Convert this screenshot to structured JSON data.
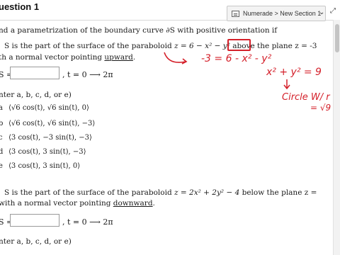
{
  "header": {
    "title": "uestion 1"
  },
  "numerade": {
    "label": "Numerade > New Section 1",
    "chevron": "⌄",
    "expand": "⤢"
  },
  "q1": {
    "intro": "nd a parametrization of the boundary curve ∂S with positive orientation if",
    "line1_a": "S is the part of the surface of the paraboloid ",
    "line1_math": "z = 6 − x² − y²",
    "line1_b": " above the plane ",
    "plane": "z = -3",
    "line2_a": "th a normal vector pointing ",
    "line2_dir": "upward",
    "line2_b": ".",
    "ds_label": "S =",
    "t_range": ", t = 0 ⟶ 2π",
    "choice_prompt": "nter a, b, c, d, or e)",
    "options": [
      {
        "letter": "a",
        "text": "⟨√6 cos(t), √6 sin(t), 0⟩"
      },
      {
        "letter": "b",
        "text": "⟨√6 cos(t), √6 sin(t), −3⟩"
      },
      {
        "letter": "c",
        "text": "⟨3 cos(t), −3 sin(t), −3⟩"
      },
      {
        "letter": "d",
        "text": "⟨3 cos(t), 3 sin(t), −3⟩"
      },
      {
        "letter": "e",
        "text": "⟨3 cos(t), 3 sin(t), 0⟩"
      }
    ]
  },
  "q2": {
    "line1_a": "S is the part of the surface of the paraboloid ",
    "line1_math": "z = 2x² + 2y² − 4",
    "line1_b": " below the plane z =",
    "line2_a": "with a normal vector pointing ",
    "line2_dir": "downward",
    "line2_b": ".",
    "ds_label": "S =",
    "t_range": ", t = 0 ⟶ 2π",
    "choice_prompt": "nter a, b, c, d, or e)"
  },
  "annotations": {
    "eq1": "-3 = 6 - x² - y²",
    "eq2": "x² + y² = 9",
    "note": "Circle W/ r",
    "radius": "= √9"
  },
  "colors": {
    "ink": "#d4202a",
    "box_border": "#9a9a9a"
  }
}
